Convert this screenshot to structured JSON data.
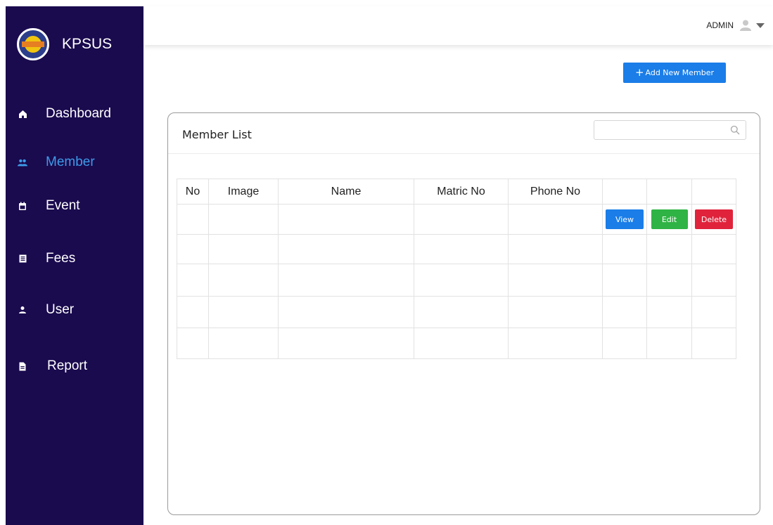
{
  "app": {
    "brand": "KPSUS"
  },
  "sidebar": {
    "items": [
      {
        "label": "Dashboard",
        "icon": "home-icon"
      },
      {
        "label": "Member",
        "icon": "users-icon",
        "active": true
      },
      {
        "label": "Event",
        "icon": "calendar-icon"
      },
      {
        "label": "Fees",
        "icon": "receipt-icon"
      },
      {
        "label": "User",
        "icon": "user-icon"
      },
      {
        "label": "Report",
        "icon": "file-icon"
      }
    ]
  },
  "topbar": {
    "user_name": "ADMIN",
    "user_icon": "avatar-icon",
    "caret_icon": "caret-down-icon"
  },
  "actions": {
    "add_member_label": "Add New Member",
    "add_icon": "plus-icon"
  },
  "card": {
    "title": "Member List",
    "search": {
      "placeholder": "",
      "icon": "search-icon"
    }
  },
  "table": {
    "columns": [
      "No",
      "Image",
      "Name",
      "Matric No",
      "Phone No",
      "",
      "",
      ""
    ],
    "rows": [
      {
        "no": "",
        "image": "",
        "name": "",
        "matric": "",
        "phone": "",
        "view": "View",
        "edit": "Edit",
        "delete": "Delete"
      },
      {
        "no": "",
        "image": "",
        "name": "",
        "matric": "",
        "phone": "",
        "view": "",
        "edit": "",
        "delete": ""
      },
      {
        "no": "",
        "image": "",
        "name": "",
        "matric": "",
        "phone": "",
        "view": "",
        "edit": "",
        "delete": ""
      },
      {
        "no": "",
        "image": "",
        "name": "",
        "matric": "",
        "phone": "",
        "view": "",
        "edit": "",
        "delete": ""
      },
      {
        "no": "",
        "image": "",
        "name": "",
        "matric": "",
        "phone": "",
        "view": "",
        "edit": "",
        "delete": ""
      }
    ]
  },
  "colors": {
    "sidebar_bg": "#1a0a4e",
    "active_nav": "#3d9be9",
    "primary": "#1a7de8",
    "success": "#2fb344",
    "danger": "#e0233b"
  }
}
